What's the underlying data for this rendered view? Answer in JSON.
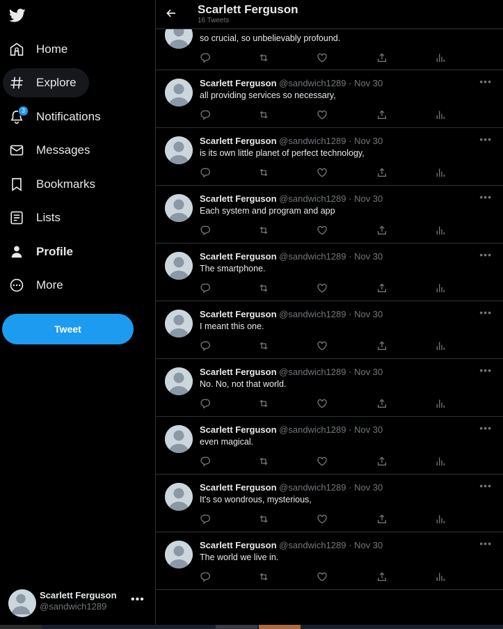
{
  "header": {
    "title": "Scarlett Ferguson",
    "subtitle": "16 Tweets"
  },
  "nav": [
    {
      "label": "Home",
      "icon": "home-icon"
    },
    {
      "label": "Explore",
      "icon": "hashtag-icon",
      "active": true
    },
    {
      "label": "Notifications",
      "icon": "bell-icon",
      "badge": "3"
    },
    {
      "label": "Messages",
      "icon": "envelope-icon"
    },
    {
      "label": "Bookmarks",
      "icon": "bookmark-icon"
    },
    {
      "label": "Lists",
      "icon": "list-icon"
    },
    {
      "label": "Profile",
      "icon": "person-icon"
    },
    {
      "label": "More",
      "icon": "more-circle-icon"
    }
  ],
  "tweet_button": "Tweet",
  "account": {
    "name": "Scarlett Ferguson",
    "handle": "@sandwich1289",
    "more": "•••"
  },
  "partial_tweet": {
    "text": "so crucial, so unbelievably profound."
  },
  "tweets": [
    {
      "name": "Scarlett Ferguson",
      "handle": "@sandwich1289",
      "dot": "·",
      "date": "Nov 30",
      "text": "all providing services so necessary,"
    },
    {
      "name": "Scarlett Ferguson",
      "handle": "@sandwich1289",
      "dot": "·",
      "date": "Nov 30",
      "text": "is its own little planet of perfect technology,"
    },
    {
      "name": "Scarlett Ferguson",
      "handle": "@sandwich1289",
      "dot": "·",
      "date": "Nov 30",
      "text": "Each system and program and app"
    },
    {
      "name": "Scarlett Ferguson",
      "handle": "@sandwich1289",
      "dot": "·",
      "date": "Nov 30",
      "text": "The smartphone."
    },
    {
      "name": "Scarlett Ferguson",
      "handle": "@sandwich1289",
      "dot": "·",
      "date": "Nov 30",
      "text": "I meant this one."
    },
    {
      "name": "Scarlett Ferguson",
      "handle": "@sandwich1289",
      "dot": "·",
      "date": "Nov 30",
      "text": "No. No, not that world."
    },
    {
      "name": "Scarlett Ferguson",
      "handle": "@sandwich1289",
      "dot": "·",
      "date": "Nov 30",
      "text": "even magical."
    },
    {
      "name": "Scarlett Ferguson",
      "handle": "@sandwich1289",
      "dot": "·",
      "date": "Nov 30",
      "text": "It's so wondrous, mysterious,"
    },
    {
      "name": "Scarlett Ferguson",
      "handle": "@sandwich1289",
      "dot": "·",
      "date": "Nov 30",
      "text": "The world we live in."
    }
  ],
  "colors": {
    "accent": "#1d9bf0",
    "background": "#000000",
    "text": "#e7e9ea",
    "muted": "#71767b",
    "border": "#2f3336"
  }
}
